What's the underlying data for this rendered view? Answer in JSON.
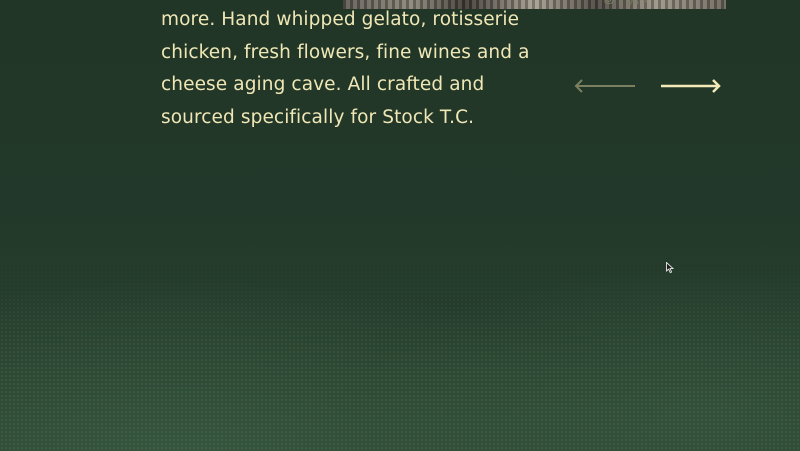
{
  "intro": {
    "lines": [
      "more. Hand whipped gelato, rotisserie",
      "chicken, fresh flowers, fine wines and a",
      "cheese aging cave. All crafted and",
      "sourced specifically for Stock T.C."
    ]
  },
  "stamp": {
    "text": "E ST W STATION K-TOR"
  },
  "carousel": {
    "prev_icon": "arrow-left-icon",
    "next_icon": "arrow-right-icon"
  },
  "colors": {
    "background": "#22382a",
    "text": "#f0e7b6",
    "arrow_active": "#f3e9b8",
    "arrow_inactive": "#7d8060",
    "stamp": "#7a7d63"
  }
}
